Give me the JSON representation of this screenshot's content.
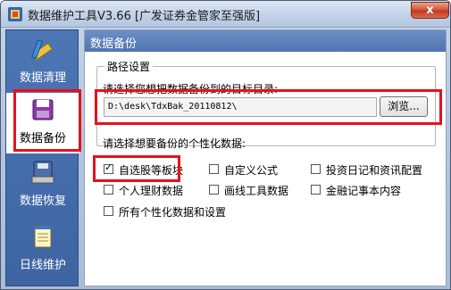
{
  "window": {
    "title": "数据维护工具V3.66 [广发证券金管家至强版]",
    "close_label": "x"
  },
  "sidebar": {
    "items": [
      {
        "label": "数据清理",
        "icon": "pencil-ruler-icon",
        "active": false
      },
      {
        "label": "数据备份",
        "icon": "backup-folder-icon",
        "active": true
      },
      {
        "label": "数据恢复",
        "icon": "restore-disk-icon",
        "active": false
      },
      {
        "label": "日线维护",
        "icon": "notepad-icon",
        "active": false
      }
    ]
  },
  "panel": {
    "title": "数据备份",
    "path_group": {
      "legend": "路径设置",
      "prompt": "请选择您想把数据备份到的目标目录:",
      "path_value": "D:\\desk\\TdxBak_20110812\\",
      "browse_label": "浏览..."
    },
    "options": {
      "prompt": "请选择想要备份的个性化数据:",
      "items": [
        {
          "label": "自选股等板块",
          "checked": true
        },
        {
          "label": "自定义公式",
          "checked": false
        },
        {
          "label": "投资日记和资讯配置",
          "checked": false
        },
        {
          "label": "个人理财数据",
          "checked": false
        },
        {
          "label": "画线工具数据",
          "checked": false
        },
        {
          "label": "金融记事本内容",
          "checked": false
        },
        {
          "label": "所有个性化数据和设置",
          "checked": false
        }
      ]
    }
  },
  "colors": {
    "highlight": "#e8101a",
    "sidebar_bg": "#4d76b5",
    "header_bg": "#5a7fb8"
  }
}
